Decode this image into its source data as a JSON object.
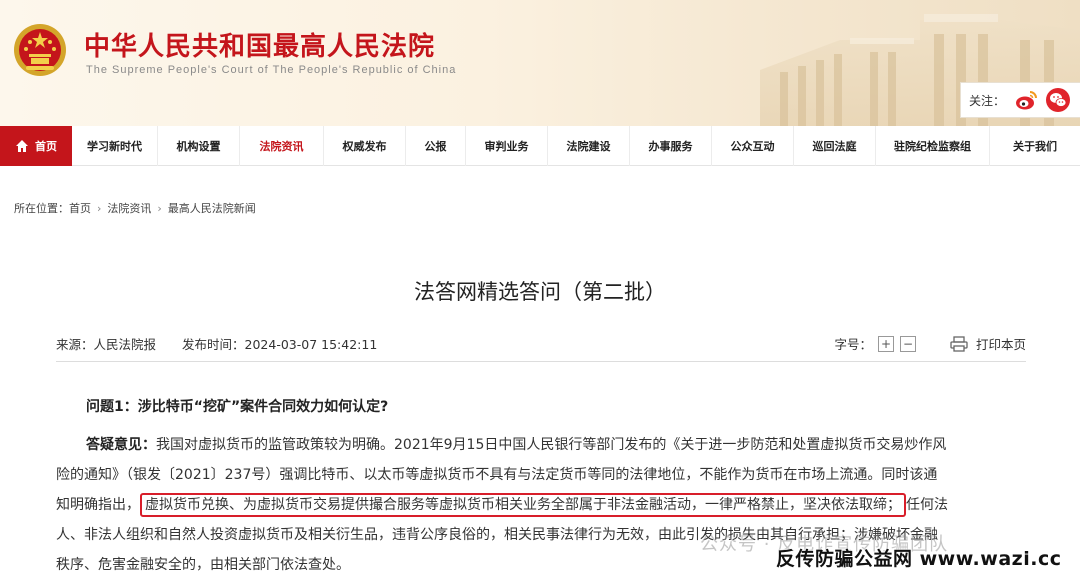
{
  "header": {
    "title": "中华人民共和国最高人民法院",
    "subtitle": "The Supreme People's Court of The People's Republic of China",
    "follow_label": "关注：",
    "brand_color": "#c4151b"
  },
  "nav": {
    "items": [
      {
        "label": "首页",
        "icon": "home-icon"
      },
      {
        "label": "学习新时代"
      },
      {
        "label": "机构设置"
      },
      {
        "label": "法院资讯"
      },
      {
        "label": "权威发布"
      },
      {
        "label": "公报"
      },
      {
        "label": "审判业务"
      },
      {
        "label": "法院建设"
      },
      {
        "label": "办事服务"
      },
      {
        "label": "公众互动"
      },
      {
        "label": "巡回法庭"
      },
      {
        "label": "驻院纪检监察组"
      },
      {
        "label": "关于我们"
      }
    ]
  },
  "breadcrumb": {
    "prefix": "所在位置：",
    "items": [
      "首页",
      "法院资讯",
      "最高人民法院新闻"
    ],
    "separator": "›"
  },
  "article": {
    "title": "法答网精选答问（第二批）",
    "source": "来源：人民法院报",
    "publish_time": "发布时间：2024-03-07 15:42:11",
    "font_size_label": "字号：",
    "font_increase": "+",
    "font_decrease": "−",
    "print_label": "打印本页",
    "question": "问题1：涉比特币“挖矿”案件合同效力如何认定?",
    "answer_label": "答疑意见：",
    "lines": {
      "l1": "我国对虚拟货币的监管政策较为明确。2021年9月15日中国人民银行等部门发布的《关于进一步防范和处置虚拟货币交易炒作风",
      "l2": "险的通知》（银发〔2021〕237号）强调比特币、以太币等虚拟货币不具有与法定货币等同的法律地位，不能作为货币在市场上流通。同时该通",
      "l3_pre": "知明确指出，",
      "l3_highlight": "虚拟货币兑换、为虚拟货币交易提供撮合服务等虚拟货币相关业务全部属于非法金融活动，一律严格禁止，坚决依法取缔；",
      "l3_post": "任何法",
      "l4": "人、非法人组织和自然人投资虚拟货币及相关衍生品，违背公序良俗的，相关民事法律行为无效，由此引发的损失由其自行承担；涉嫌破坏金融",
      "l5": "秩序、危害金融安全的，由相关部门依法查处。"
    },
    "highlight_color": "#d81e2a"
  },
  "watermark": {
    "gray": "公众号 · 反电诈宣传防骗团队",
    "brand": "反传防骗公益网 www.wazi.cc"
  }
}
